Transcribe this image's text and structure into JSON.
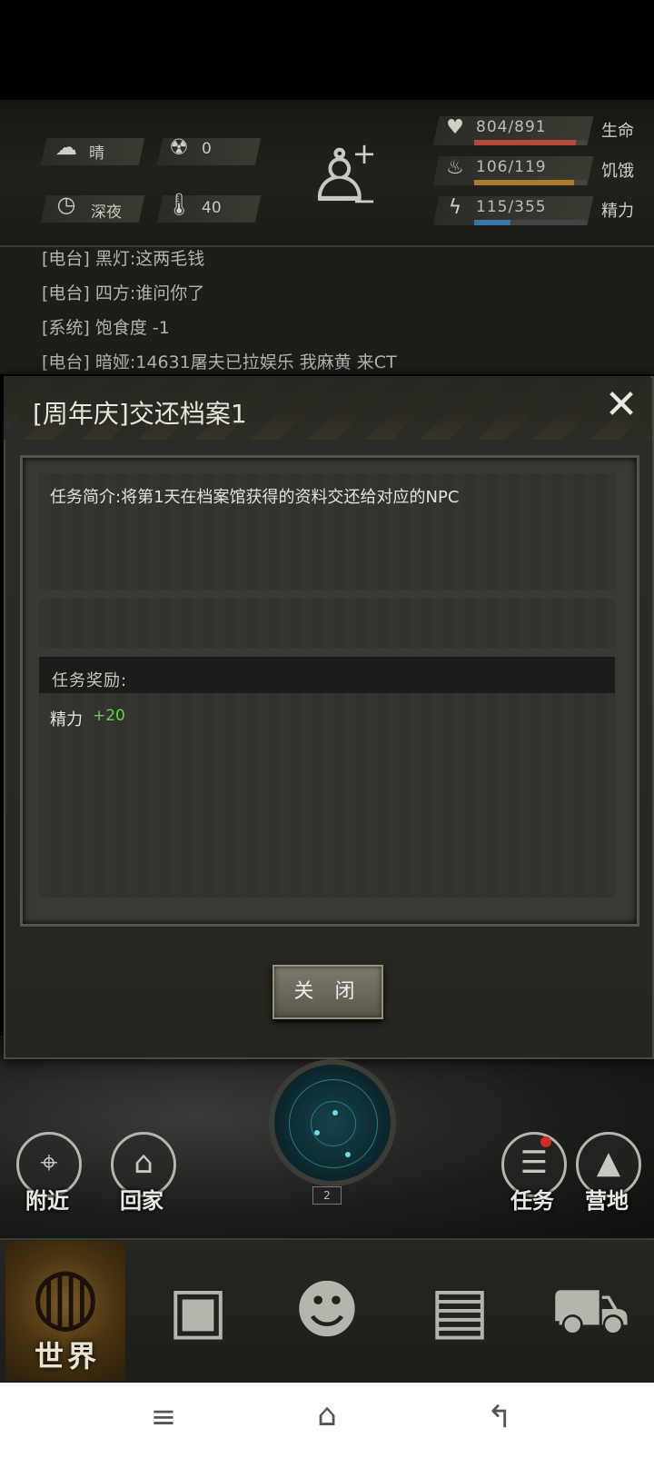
{
  "status": {
    "weather": "晴",
    "radiation": "0",
    "time_of_day": "深夜",
    "temperature": "40",
    "stats": [
      {
        "label": "生命",
        "value": "804/891",
        "fill": 0.902,
        "color": "#b54a3a"
      },
      {
        "label": "饥饿",
        "value": "106/119",
        "fill": 0.891,
        "color": "#b07a2e"
      },
      {
        "label": "精力",
        "value": "115/355",
        "fill": 0.324,
        "color": "#3a76a6"
      }
    ]
  },
  "chat": [
    "[电台] 黑灯:这两毛钱",
    "[电台] 四方:谁问你了",
    "[系统] 饱食度 -1",
    "[电台] 暗娅:14631屠夫已拉娱乐 我麻黄 来CT"
  ],
  "dialog": {
    "title": "[周年庆]交还档案1",
    "description": "任务简介:将第1天在档案馆获得的资料交还给对应的NPC",
    "reward_header": "任务奖励:",
    "rewards": [
      {
        "name": "精力",
        "value": "+20"
      }
    ],
    "close_label": "关 闭"
  },
  "actions": {
    "nearby": "附近",
    "home": "回家",
    "tasks": "任务",
    "camp": "营地",
    "radar_badge": "2"
  },
  "nav": {
    "world": "世界",
    "items": [
      "backpack-icon",
      "skills-head-icon",
      "radio-icon",
      "shop-cart-icon"
    ]
  },
  "colors": {
    "reward_positive": "#5fd34a",
    "accent": "#e3a33a"
  }
}
